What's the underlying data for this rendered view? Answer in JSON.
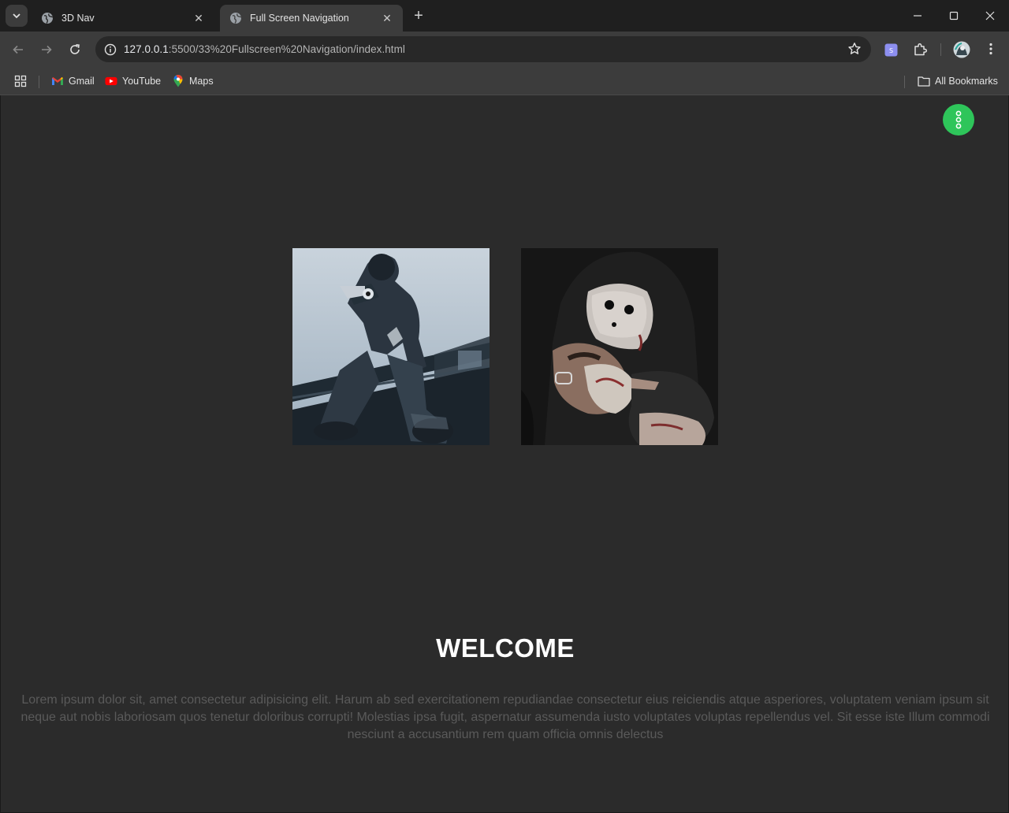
{
  "browser": {
    "tabs": [
      {
        "title": "3D Nav",
        "active": false
      },
      {
        "title": "Full Screen Navigation",
        "active": true
      }
    ],
    "url_host": "127.0.0.1",
    "url_rest": ":5500/33%20Fullscreen%20Navigation/index.html",
    "bookmarks": [
      {
        "label": "Gmail",
        "icon": "gmail-icon"
      },
      {
        "label": "YouTube",
        "icon": "youtube-icon"
      },
      {
        "label": "Maps",
        "icon": "maps-icon"
      }
    ],
    "all_bookmarks_label": "All Bookmarks"
  },
  "page": {
    "heading": "WELCOME",
    "paragraph": "Lorem ipsum dolor sit, amet consectetur adipisicing elit. Harum ab sed exercitationem repudiandae consectetur eius reiciendis atque asperiores, voluptatem veniam ipsum sit neque aut nobis laboriosam quos tenetur doloribus corrupti! Molestias ipsa fugit, aspernatur assumenda iusto voluptates voluptas repellendus vel. Sit esse iste Illum commodi nesciunt a accusantium rem quam officia omnis delectus",
    "images": [
      {
        "alt_icon": "masked-figure-with-gun-image"
      },
      {
        "alt_icon": "masked-figure-with-hostage-image"
      }
    ],
    "menu_button_icon": "vertical-dots-icon"
  },
  "colors": {
    "page_bg": "#2b2b2b",
    "fab": "#2ec55a",
    "heading": "#ffffff",
    "paragraph": "#5a5a5a"
  }
}
